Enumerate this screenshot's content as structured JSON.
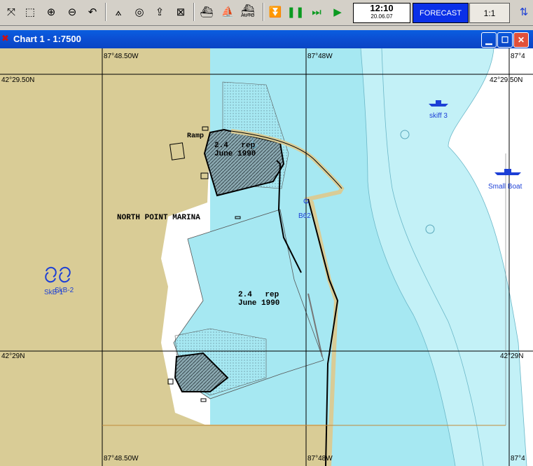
{
  "toolbar": {
    "auto_label": "AUTO",
    "time": "12:10",
    "date": "20.06.07",
    "forecast_label": "FORECAST",
    "scale_label": "1:1"
  },
  "window": {
    "title": "Chart 1 - 1:7500"
  },
  "chart": {
    "lon_labels": {
      "top_left": "87°48.50W",
      "top_mid": "87°48W",
      "top_right": "87°4",
      "bottom_left": "87°48.50W",
      "bottom_mid": "87°48W",
      "bottom_right": "87°4"
    },
    "lat_labels": {
      "north_left": "42°29.50N",
      "north_right": "42°29.50N",
      "south_left": "42°29N",
      "south_right": "42°29N"
    },
    "place_name": "NORTH POINT MARINA",
    "ramp_label": "Ramp",
    "depth_note_1": {
      "depth": "2.4",
      "rep": "rep",
      "date": "June 1990"
    },
    "depth_note_2": {
      "depth": "2.4",
      "rep": "rep",
      "date": "June 1990"
    },
    "buoy_label": "B62",
    "target_labels": {
      "skiff": "skiff 3",
      "small_boat": "Small Boat",
      "skb1": "SkB-1",
      "skb2": "SkB-2"
    }
  },
  "colors": {
    "land": "#d9cc96",
    "shallow": "#a6e8f2",
    "mid": "#c3f1f7",
    "deep": "#ffffff",
    "title_blue": "#0b4ed2"
  }
}
